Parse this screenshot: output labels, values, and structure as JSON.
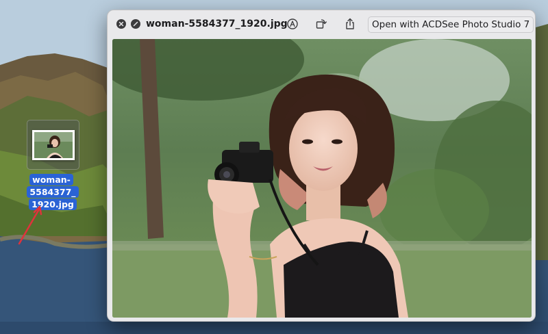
{
  "desktop": {
    "file": {
      "name": "woman-5584377_1920.jpg",
      "label_line1": "woman-5584377_",
      "label_line2": "1920.jpg"
    }
  },
  "quicklook": {
    "title": "woman-5584377_1920.jpg",
    "open_with_label": "Open with ACDSee Photo Studio 7",
    "icons": {
      "close": "close-icon",
      "fullscreen": "fullscreen-icon",
      "markup": "markup-icon",
      "rotate": "rotate-icon",
      "share": "share-icon"
    }
  },
  "colors": {
    "selection": "#2a63d5",
    "arrow": "#e0323c",
    "window_bg": "#e9e9eb"
  }
}
